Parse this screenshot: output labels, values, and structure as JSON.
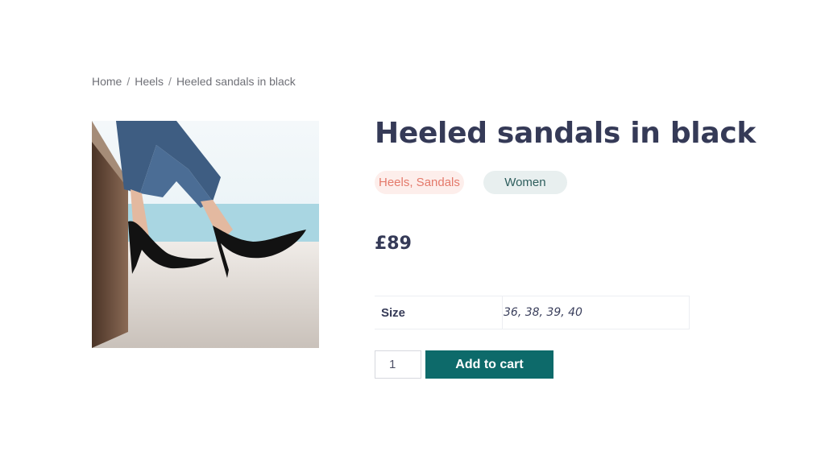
{
  "breadcrumb": {
    "home": "Home",
    "separator": "/",
    "category": "Heels",
    "current": "Heeled sandals in black"
  },
  "product": {
    "image_alt": "heeled-sandals-photo",
    "title": "Heeled sandals in black",
    "categories_tag": "Heels, Sandals",
    "gender_tag": "Women",
    "price": "£89",
    "attributes": [
      {
        "label": "Size",
        "value": "36, 38, 39, 40"
      }
    ],
    "quantity": "1",
    "add_to_cart_label": "Add to cart"
  },
  "colors": {
    "accent": "#0d6a6a",
    "title": "#353a57",
    "category_tag_text": "#e47a6b",
    "category_tag_bg": "#fdeeeb",
    "gender_tag_bg": "#e8efef"
  }
}
